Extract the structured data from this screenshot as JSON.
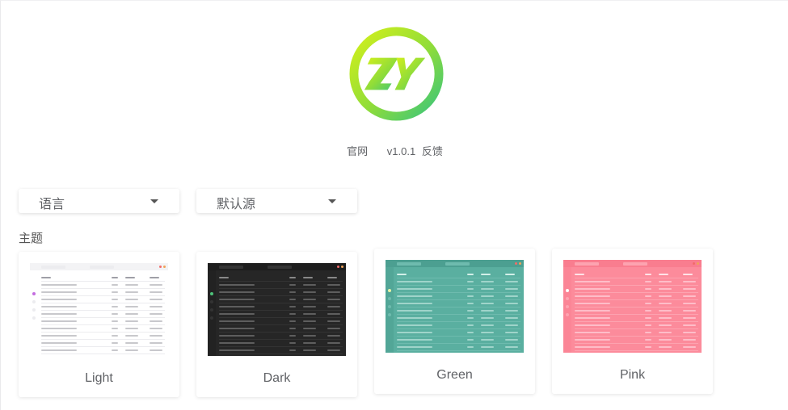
{
  "header": {
    "site_link": "官网",
    "version": "v1.0.1",
    "feedback_link": "反馈"
  },
  "settings": {
    "language_select": {
      "value": "语言"
    },
    "source_select": {
      "value": "默认源"
    }
  },
  "themes": {
    "title": "主题",
    "items": [
      {
        "label": "Light",
        "bg": "#ffffff",
        "bar": "#f3f3f5",
        "side": "#ffffff",
        "line": "#ececef",
        "text": "#9a9aa2",
        "accent": "#c46de0"
      },
      {
        "label": "Dark",
        "bg": "#262626",
        "bar": "#1d1d1d",
        "side": "#222222",
        "line": "#333333",
        "text": "#8d8d8d",
        "accent": "#4ec27a"
      },
      {
        "label": "Green",
        "bg": "#5aafa0",
        "bar": "#4c9f91",
        "side": "#52a697",
        "line": "#6ebbae",
        "text": "#d9f2ec",
        "accent": "#e7f3a5"
      },
      {
        "label": "Pink",
        "bg": "#fc8b9b",
        "bar": "#f97d8f",
        "side": "#fb8596",
        "line": "#fda3b0",
        "text": "#ffe8ec",
        "accent": "#ffffff"
      }
    ]
  },
  "colors": {
    "logo_gradient_start": "#c8ee1e",
    "logo_gradient_end": "#3fc87a"
  },
  "icons": {
    "logo": "zy-logo-icon",
    "dropdown": "caret-down-icon"
  }
}
